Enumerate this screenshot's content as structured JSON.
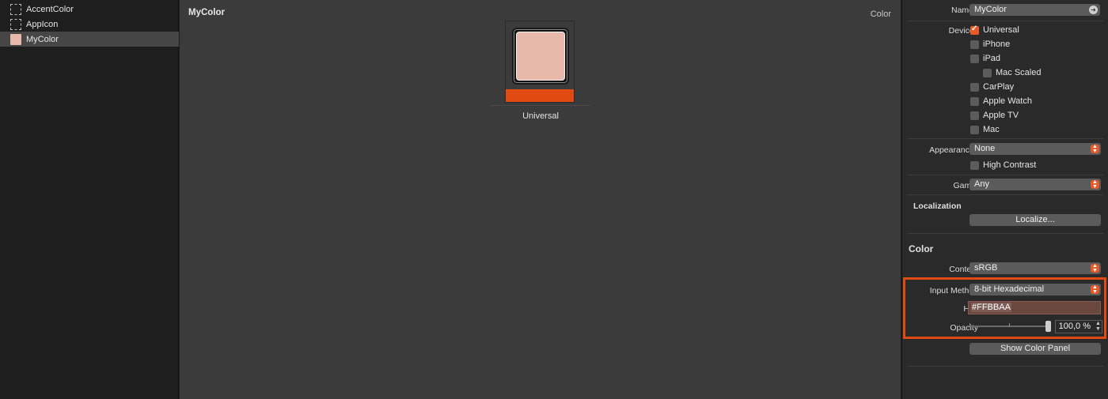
{
  "assets": [
    {
      "label": "AccentColor",
      "thumb": "dashed-placeholder"
    },
    {
      "label": "AppIcon",
      "thumb": "dashed-placeholder"
    },
    {
      "label": "MyColor",
      "thumb": "color-swatch",
      "selected": true
    }
  ],
  "main": {
    "title": "MyColor",
    "kind": "Color",
    "well_label": "Universal",
    "swatch_color": "#E8B9AB",
    "accent_color": "#E14A12"
  },
  "inspector": {
    "name_label": "Name",
    "name_value": "MyColor",
    "devices_label": "Devices",
    "devices": [
      {
        "label": "Universal",
        "checked": true
      },
      {
        "label": "iPhone",
        "checked": false
      },
      {
        "label": "iPad",
        "checked": false
      },
      {
        "label": "Mac Scaled",
        "checked": false
      },
      {
        "label": "CarPlay",
        "checked": false
      },
      {
        "label": "Apple Watch",
        "checked": false
      },
      {
        "label": "Apple TV",
        "checked": false
      },
      {
        "label": "Mac",
        "checked": false
      }
    ],
    "appearances_label": "Appearances",
    "appearances_value": "None",
    "high_contrast_label": "High Contrast",
    "gamut_label": "Gamut",
    "gamut_value": "Any",
    "localization_title": "Localization",
    "localize_button": "Localize...",
    "color_title": "Color",
    "content_label": "Content",
    "content_value": "sRGB",
    "input_method_label": "Input Method",
    "input_method_value": "8-bit Hexadecimal",
    "hex_label": "Hex",
    "hex_value": "#FFBBAA",
    "opacity_label": "Opacity",
    "opacity_value": "100,0 %",
    "opacity_fraction": 1.0,
    "show_color_panel_button": "Show Color Panel"
  }
}
